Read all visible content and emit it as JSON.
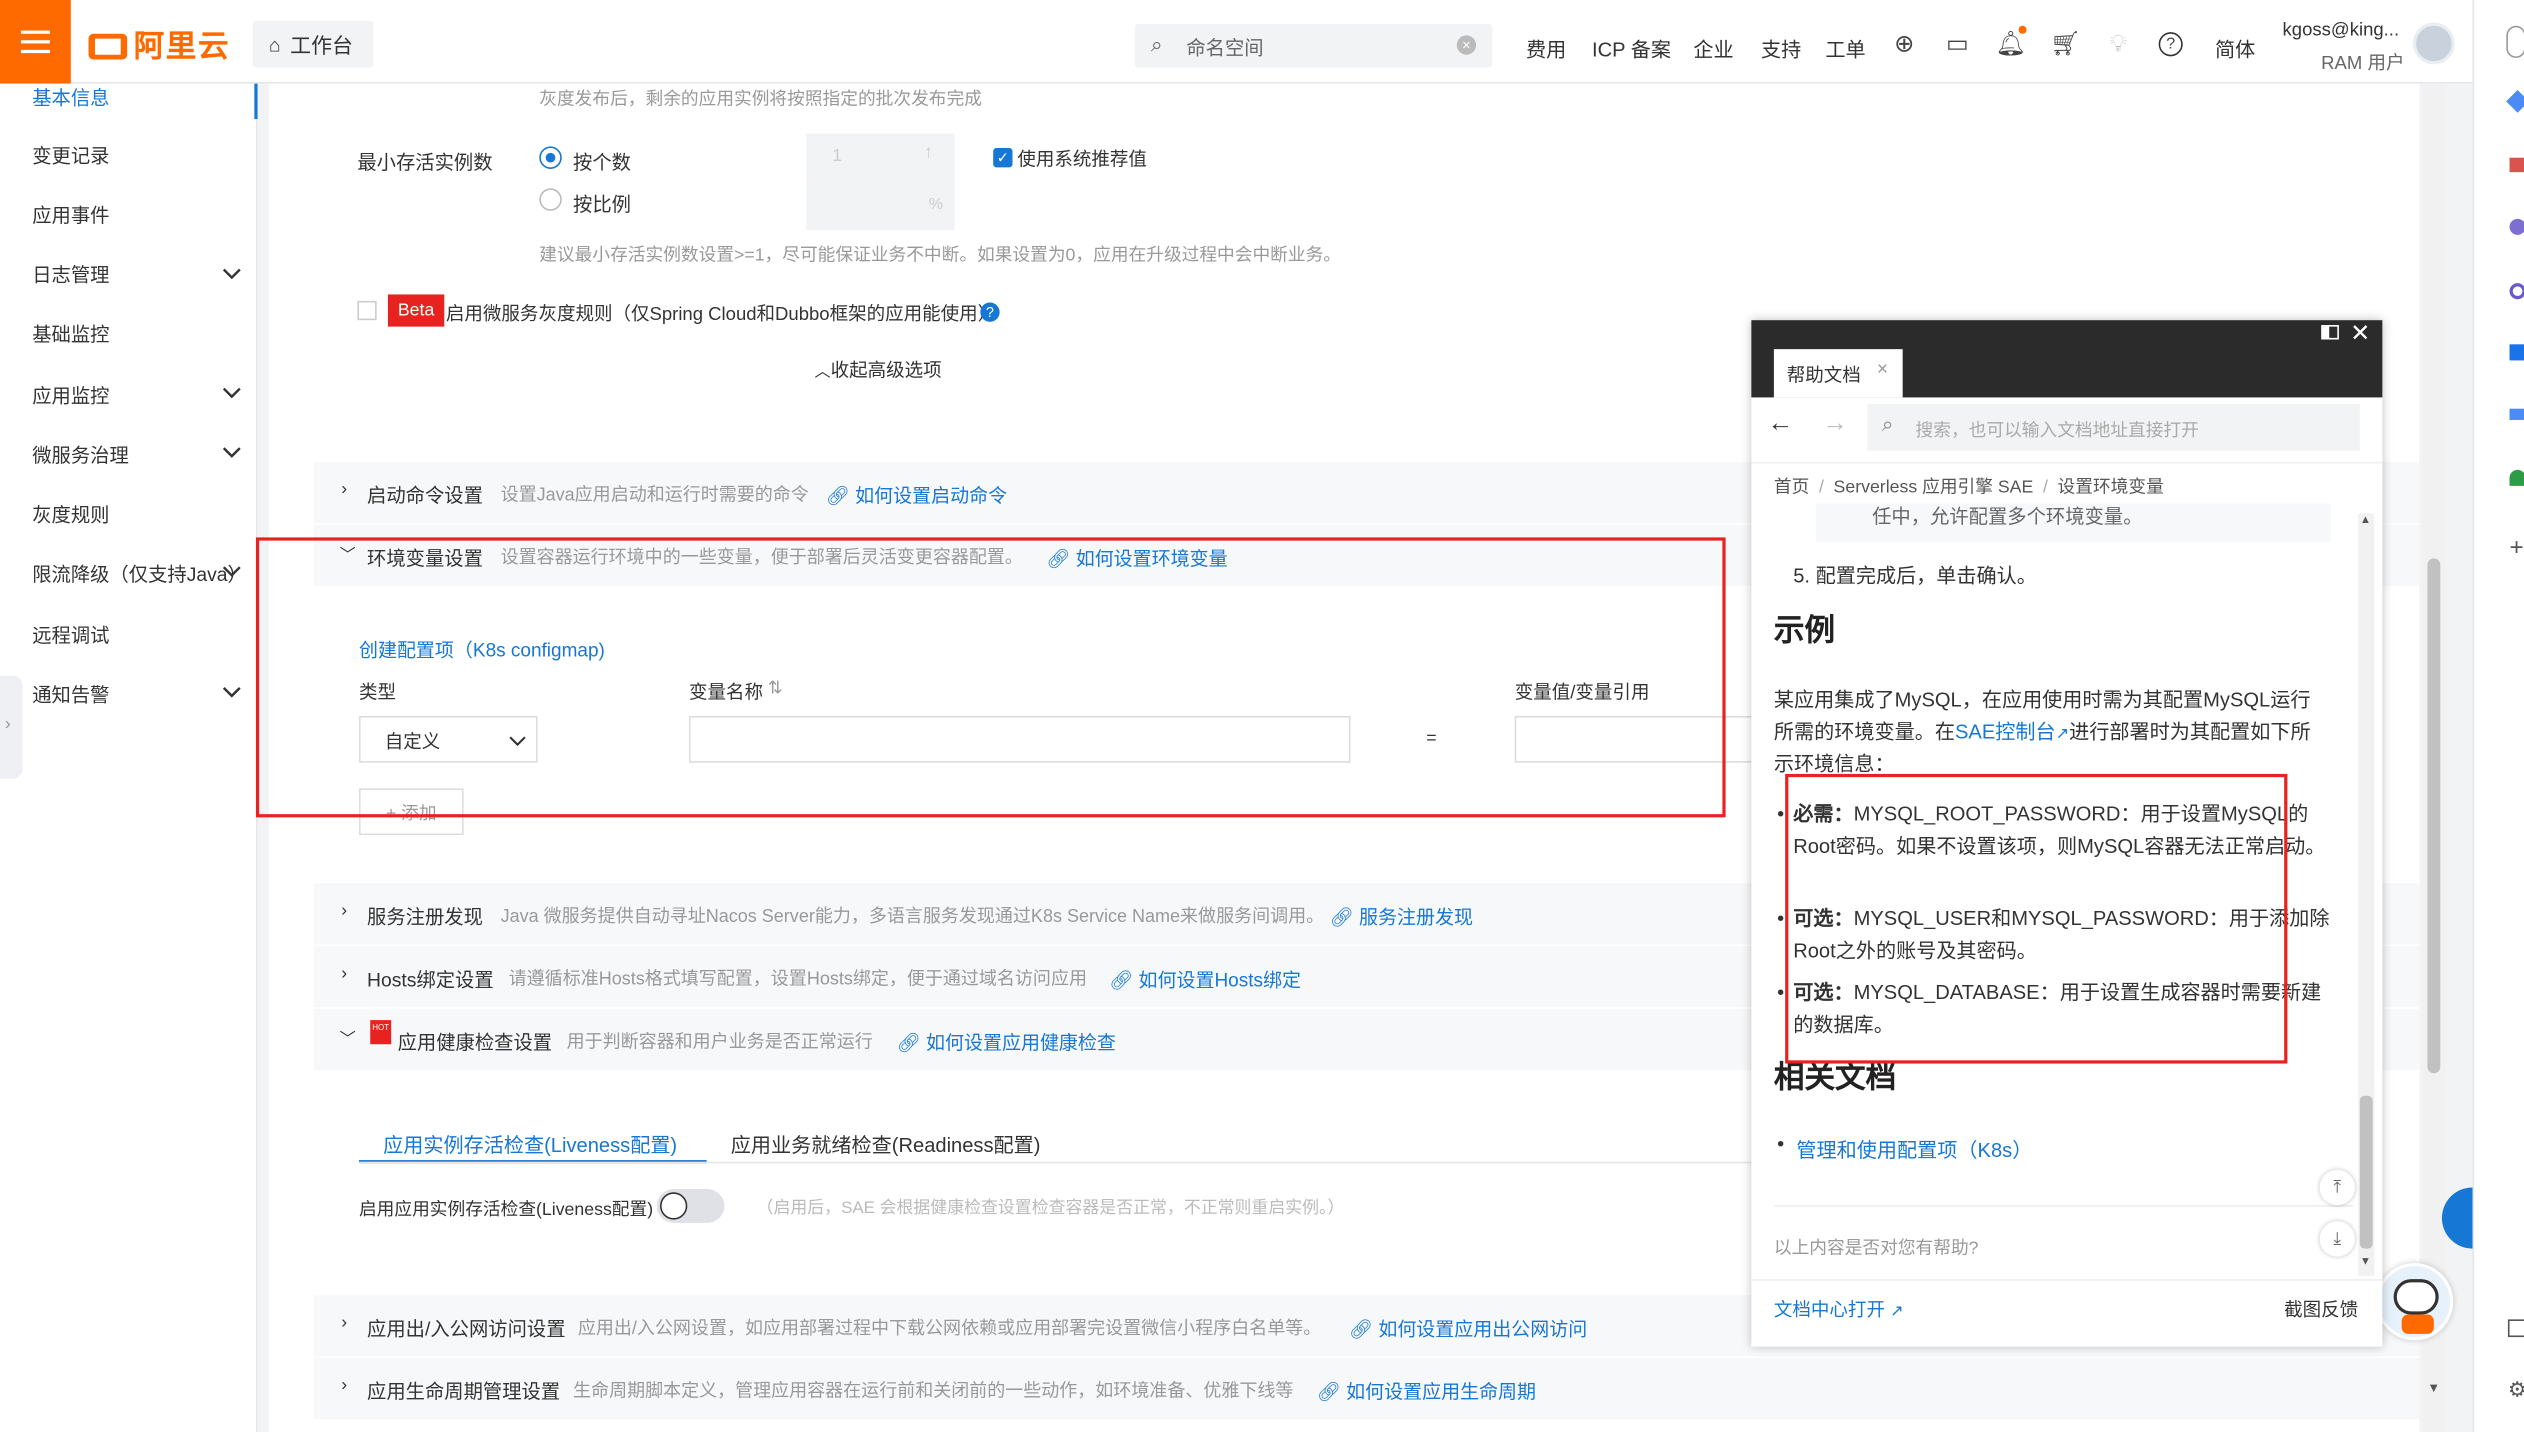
{
  "topbar": {
    "logo": "阿里云",
    "workbench": "工作台",
    "search_placeholder": "命名空间",
    "nav": [
      "费用",
      "ICP 备案",
      "企业",
      "支持",
      "工单"
    ],
    "lang": "简体",
    "user_name": "kgoss@king...",
    "user_role": "RAM 用户"
  },
  "sidebar": {
    "items": [
      {
        "label": "基本信息",
        "active": true
      },
      {
        "label": "变更记录"
      },
      {
        "label": "应用事件"
      },
      {
        "label": "日志管理",
        "expandable": true
      },
      {
        "label": "基础监控"
      },
      {
        "label": "应用监控",
        "expandable": true
      },
      {
        "label": "微服务治理",
        "expandable": true
      },
      {
        "label": "灰度规则"
      },
      {
        "label": "限流降级（仅支持Java）",
        "expandable": true
      },
      {
        "label": "远程调试"
      },
      {
        "label": "通知告警",
        "expandable": true
      }
    ]
  },
  "gray_release": {
    "note": "灰度发布后，剩余的应用实例将按照指定的批次发布完成"
  },
  "min_instances": {
    "label": "最小存活实例数",
    "opt_count": "按个数",
    "opt_ratio": "按比例",
    "count_value": "1",
    "percent_sign": "%",
    "use_recommended": "使用系统推荐值",
    "hint": "建议最小存活实例数设置>=1，尽可能保证业务不中断。如果设置为0，应用在升级过程中会中断业务。"
  },
  "microservice_gray": {
    "badge": "Beta",
    "label": "启用微服务灰度规则（仅Spring Cloud和Dubbo框架的应用能使用）"
  },
  "collapse_advanced": "收起高级选项",
  "sections": {
    "startup": {
      "title": "启动命令设置",
      "desc": "设置Java应用启动和运行时需要的命令",
      "link": "如何设置启动命令"
    },
    "env": {
      "title": "环境变量设置",
      "desc": "设置容器运行环境中的一些变量，便于部署后灵活变更容器配置。",
      "link": "如何设置环境变量"
    },
    "registry": {
      "title": "服务注册发现",
      "desc": "Java 微服务提供自动寻址Nacos Server能力，多语言服务发现通过K8s Service Name来做服务间调用。",
      "link": "服务注册发现"
    },
    "hosts": {
      "title": "Hosts绑定设置",
      "desc": "请遵循标准Hosts格式填写配置，设置Hosts绑定，便于通过域名访问应用",
      "link": "如何设置Hosts绑定"
    },
    "health": {
      "title": "应用健康检查设置",
      "desc": "用于判断容器和用户业务是否正常运行",
      "link": "如何设置应用健康检查",
      "hot": "HOT"
    },
    "network": {
      "title": "应用出/入公网访问设置",
      "desc": "应用出/入公网设置，如应用部署过程中下载公网依赖或应用部署完设置微信小程序白名单等。",
      "link": "如何设置应用出公网访问"
    },
    "lifecycle": {
      "title": "应用生命周期管理设置",
      "desc": "生命周期脚本定义，管理应用容器在运行前和关闭前的一些动作，如环境准备、优雅下线等",
      "link": "如何设置应用生命周期"
    }
  },
  "env_form": {
    "create_config": "创建配置项（K8s configmap)",
    "col_type": "类型",
    "col_name": "变量名称",
    "col_value": "变量值/变量引用",
    "type_value": "自定义",
    "equals": "=",
    "add_button": "+ 添加"
  },
  "health_tabs": {
    "liveness": "应用实例存活检查(Liveness配置)",
    "readiness": "应用业务就绪检查(Readiness配置)",
    "toggle_label": "启用应用实例存活检查(Liveness配置)",
    "toggle_hint": "（启用后，SAE 会根据健康检查设置检查容器是否正常，不正常则重启实例。）"
  },
  "help": {
    "tab": "帮助文档",
    "search_placeholder": "搜索，也可以输入文档地址直接打开",
    "breadcrumb": [
      "首页",
      "Serverless 应用引擎 SAE",
      "设置环境变量"
    ],
    "cut_line": "任中，允许配置多个环境变量。",
    "step5": "5. 配置完成后，单击确认。",
    "example_title": "示例",
    "para1": "某应用集成了MySQL，在应用使用时需为其配置MySQL运行所需的环境变量。在",
    "para1_link": "SAE控制台",
    "para1_rest": "进行部署时为其配置如下所示环境信息：",
    "bullets": [
      {
        "bold": "必需：",
        "text": "MYSQL_ROOT_PASSWORD：用于设置MySQL的Root密码。如果不设置该项，则MySQL容器无法正常启动。"
      },
      {
        "bold": "可选：",
        "text": "MYSQL_USER和MYSQL_PASSWORD：用于添加除Root之外的账号及其密码。"
      },
      {
        "bold": "可选：",
        "text": "MYSQL_DATABASE：用于设置生成容器时需要新建的数据库。"
      }
    ],
    "related_title": "相关文档",
    "related_link": "管理和使用配置项（K8s）",
    "feedback_q": "以上内容是否对您有帮助?",
    "open_center": "文档中心打开",
    "screenshot_feedback": "截图反馈"
  },
  "colors": {
    "brand": "#ff6a00",
    "link": "#1677d4",
    "highlight": "#e8231f",
    "beta": "#e8231f"
  }
}
